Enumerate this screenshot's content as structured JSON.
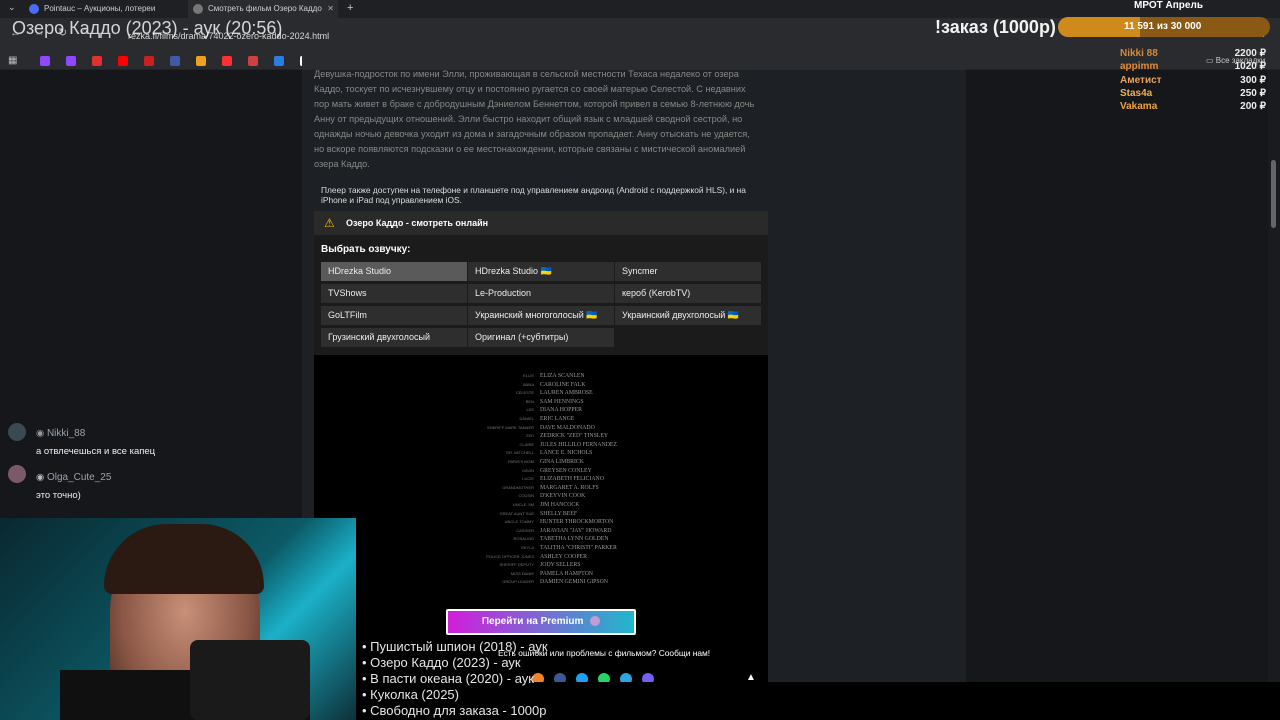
{
  "stream": {
    "title": "Озеро Каддо (2023) - аук (20:56)",
    "order_title": "!заказ (1000р)",
    "goal_label": "МРОТ Апрель",
    "goal_progress": "11 591   из 30 000",
    "goal_fraction": 0.386,
    "donors": [
      {
        "name": "Nikki 88",
        "amount": "2200 ₽",
        "color": "#d6893a"
      },
      {
        "name": "appimm",
        "amount": "1020 ₽",
        "color": "#e08a3c"
      },
      {
        "name": "Аметист",
        "amount": "300 ₽",
        "color": "#e6a45a"
      },
      {
        "name": "Stas4a",
        "amount": "250 ₽",
        "color": "#f0b14a"
      },
      {
        "name": "Vakama",
        "amount": "200 ₽",
        "color": "#f0a23a"
      }
    ],
    "chat": [
      {
        "user": "Nikki_88",
        "text": "а отвлечешься и все капец"
      },
      {
        "user": "Olga_Cute_25",
        "text": "это точно)"
      }
    ],
    "queue": [
      "• Пушистый шпион (2018) - аук",
      "• Озеро Каддо (2023) - аук",
      "• В пасти океана (2020) - аук",
      "• Куколка (2025)",
      "• Свободно для заказа - 1000р"
    ]
  },
  "browser": {
    "tabs": [
      {
        "label": "Pointauc – Аукционы, лотереи"
      },
      {
        "label": "Смотреть фильм Озеро Каддо"
      }
    ],
    "url": "rezka.fi/films/drama/74022-ozero-kaddo-2024.html",
    "bookmarks_more": "Все закладки"
  },
  "film": {
    "description": [
      "Девушка-подросток по имени Элли, проживающая в сельской местности Техаса недалеко от озера",
      "Каддо, тоскует по исчезнувшему отцу и постоянно ругается со своей матерью Селестой. С недавних",
      "пор мать живет в браке с добродушным Дэниелом Беннеттом, которой привел в семью 8-летнюю дочь",
      "Анну от предыдущих отношений. Элли быстро находит общий язык с младшей сводной сестрой, но",
      "однажды ночью девочка уходит из дома и загадочным образом пропадает. Анну отыскать не удается,",
      "но вскоре появляются подсказки о ее местонахождении, которые связаны с мистической аномалией",
      "озера Каддо."
    ],
    "player_note": "Плеер также доступен на телефоне и планшете под управлением андроид (Android с поддержкой HLS), и на iPhone и iPad под управлением iOS.",
    "watch_title": "Озеро Каддо - смотреть онлайн",
    "voice_label": "Выбрать озвучку:",
    "voices": [
      "HDrezka Studio",
      "HDrezka Studio 🇺🇦",
      "Syncmer",
      "TVShows",
      "Le-Production",
      "кероб (KerobTV)",
      "GoLTFilm",
      "Украинский многоголосый 🇺🇦",
      "Украинский двухголосый 🇺🇦",
      "Грузинский двухголосый",
      "Оригинал (+субтитры)"
    ],
    "credits": [
      {
        "role": "ELLIE",
        "name": "ELIZA SCANLEN"
      },
      {
        "role": "ANNA",
        "name": "CAROLINE FALK"
      },
      {
        "role": "CELESTE",
        "name": "LAUREN AMBROSE"
      },
      {
        "role": "BEN",
        "name": "SAM HENNINGS"
      },
      {
        "role": "LEE",
        "name": "DIANA HOPPER"
      },
      {
        "role": "DANIEL",
        "name": "ERIC LANGE"
      },
      {
        "role": "SHERIFF MARK TANNER",
        "name": "DAVE MALDONADO"
      },
      {
        "role": "ZED",
        "name": "ZEDRICK \"ZED\" TINSLEY"
      },
      {
        "role": "CLAIRE",
        "name": "JULES HILLILO FERNANDEZ"
      },
      {
        "role": "DR. MITCHELL",
        "name": "LANCE E. NICHOLS"
      },
      {
        "role": "PARIS'S MOM",
        "name": "GINA LIMBRICK"
      },
      {
        "role": "GAVIN",
        "name": "GREYSEN CONLEY"
      },
      {
        "role": "LUCIE",
        "name": "ELIZABETH FELICIANO"
      },
      {
        "role": "GRANDMOTHER",
        "name": "MARGARET A. ROLFS"
      },
      {
        "role": "COUSIN",
        "name": "D'KEYVIN COOK"
      },
      {
        "role": "UNCLE JIM",
        "name": "JIM HANCOCK"
      },
      {
        "role": "GREAT AUNT SUE",
        "name": "SHELLY BEEF"
      },
      {
        "role": "UNCLE TOMMY",
        "name": "HUNTER THROCKMORTON"
      },
      {
        "role": "CASHIER",
        "name": "JARAVIAN \"JAY\" HOWARD"
      },
      {
        "role": "ROSALIND",
        "name": "TABETHA LYNN GOLDEN"
      },
      {
        "role": "SKYLA",
        "name": "TALITHA \"CHRISTI\" PARKER"
      },
      {
        "role": "POLICE OFFICER JONES",
        "name": "ASHLEY COOPER"
      },
      {
        "role": "SHERIFF DEPUTY",
        "name": "JODY SELLERS"
      },
      {
        "role": "MISS DANIE",
        "name": "PAMELA HAMPTON"
      },
      {
        "role": "GROUP LEADER",
        "name": "DAMIEN GEMINI GIPSON"
      }
    ],
    "premium_label": "Перейти на Premium",
    "report_text": "Есть ошибки или проблемы с фильмом? Сообщи нам!"
  },
  "colors": {
    "share": [
      "#f3822a",
      "#3b5998",
      "#1da1f2",
      "#25d366",
      "#2ca5e0",
      "#7360f2"
    ],
    "bookmarks": [
      "#9146ff",
      "#9146ff",
      "#e03030",
      "#ff0000",
      "#cc2020",
      "#3f5ba8",
      "#f0a020",
      "#ff3030",
      "#d04040",
      "#2a7de1",
      "#ffffff",
      "#8a5cf6",
      "#e0a020",
      "#ff6a00",
      "#26a541",
      "#ff2020",
      "#f1c40f",
      "#ffffff",
      "#e91e63",
      "#555",
      "#ffffff",
      "#ff4d4d",
      "#ffffff",
      "#0088cc",
      "#0088cc",
      "#7360f2",
      "#ffffff",
      "#ffffff",
      "#d84b9b",
      "#ffffff",
      "#7b68ee"
    ]
  }
}
